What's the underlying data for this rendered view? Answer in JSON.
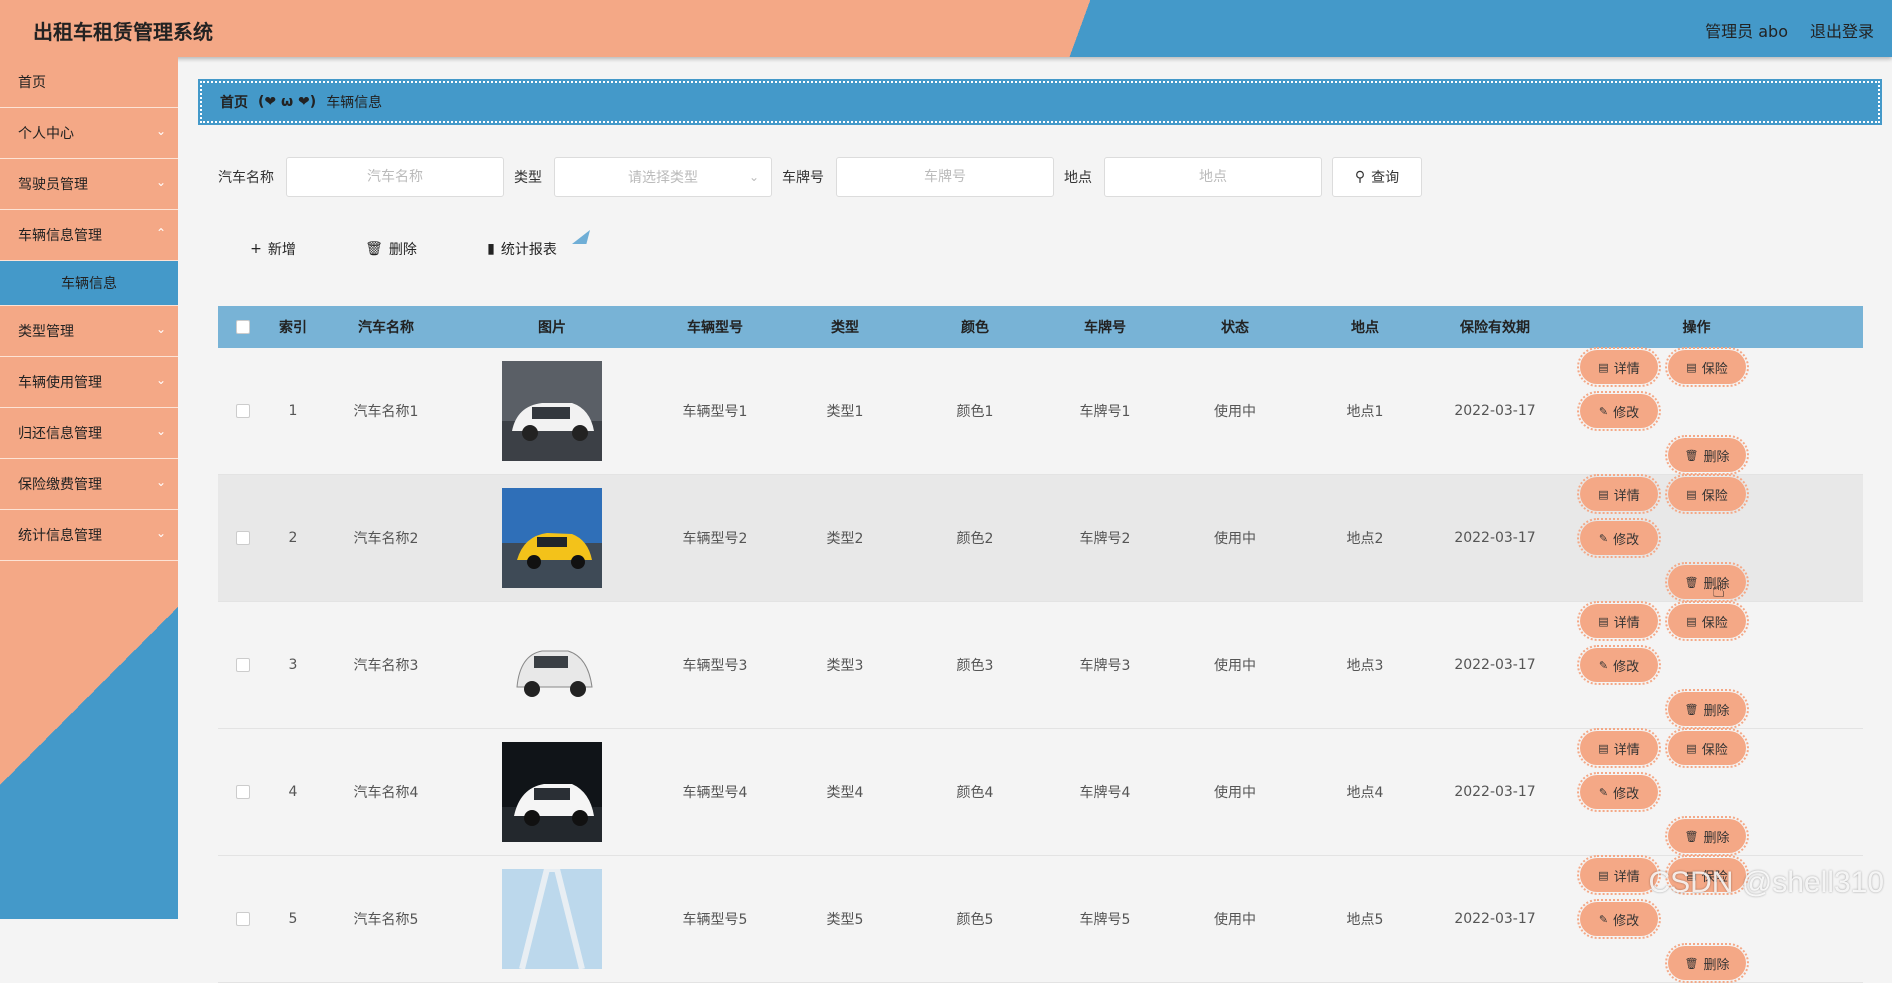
{
  "header": {
    "title": "出租车租赁管理系统",
    "user": "管理员 abo",
    "logout": "退出登录"
  },
  "sidebar": {
    "items": [
      {
        "label": "首页",
        "has_children": false
      },
      {
        "label": "个人中心",
        "has_children": true
      },
      {
        "label": "驾驶员管理",
        "has_children": true
      },
      {
        "label": "车辆信息管理",
        "has_children": true,
        "expanded": true
      },
      {
        "label": "类型管理",
        "has_children": true
      },
      {
        "label": "车辆使用管理",
        "has_children": true
      },
      {
        "label": "归还信息管理",
        "has_children": true
      },
      {
        "label": "保险缴费管理",
        "has_children": true
      },
      {
        "label": "统计信息管理",
        "has_children": true
      }
    ],
    "active_sub": "车辆信息"
  },
  "breadcrumb": {
    "home": "首页",
    "sep": "(❤ ω ❤)",
    "current": "车辆信息"
  },
  "search": {
    "name_label": "汽车名称",
    "name_placeholder": "汽车名称",
    "type_label": "类型",
    "type_placeholder": "请选择类型",
    "plate_label": "车牌号",
    "plate_placeholder": "车牌号",
    "loc_label": "地点",
    "loc_placeholder": "地点",
    "query": "查询"
  },
  "actions": {
    "add": "新增",
    "delete": "删除",
    "stats": "统计报表"
  },
  "table": {
    "headers": {
      "index": "索引",
      "name": "汽车名称",
      "image": "图片",
      "model": "车辆型号",
      "type": "类型",
      "color": "颜色",
      "plate": "车牌号",
      "status": "状态",
      "location": "地点",
      "expiry": "保险有效期",
      "ops": "操作"
    },
    "op_labels": {
      "detail": "详情",
      "insurance": "保险",
      "edit": "修改",
      "delete": "删除"
    },
    "rows": [
      {
        "index": "1",
        "name": "汽车名称1",
        "model": "车辆型号1",
        "type": "类型1",
        "color": "颜色1",
        "plate": "车牌号1",
        "status": "使用中",
        "location": "地点1",
        "expiry": "2022-03-17"
      },
      {
        "index": "2",
        "name": "汽车名称2",
        "model": "车辆型号2",
        "type": "类型2",
        "color": "颜色2",
        "plate": "车牌号2",
        "status": "使用中",
        "location": "地点2",
        "expiry": "2022-03-17"
      },
      {
        "index": "3",
        "name": "汽车名称3",
        "model": "车辆型号3",
        "type": "类型3",
        "color": "颜色3",
        "plate": "车牌号3",
        "status": "使用中",
        "location": "地点3",
        "expiry": "2022-03-17"
      },
      {
        "index": "4",
        "name": "汽车名称4",
        "model": "车辆型号4",
        "type": "类型4",
        "color": "颜色4",
        "plate": "车牌号4",
        "status": "使用中",
        "location": "地点4",
        "expiry": "2022-03-17"
      },
      {
        "index": "5",
        "name": "汽车名称5",
        "model": "车辆型号5",
        "type": "类型5",
        "color": "颜色5",
        "plate": "车牌号5",
        "status": "使用中",
        "location": "地点5",
        "expiry": "2022-03-17"
      }
    ]
  },
  "watermark": "CSDN @shell310",
  "colors": {
    "peach": "#f4a886",
    "blue": "#4499c9",
    "header_blue": "#78b3d6"
  }
}
